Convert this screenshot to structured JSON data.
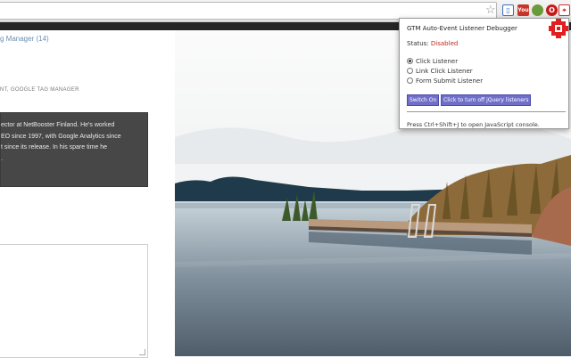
{
  "browser": {
    "extensions": [
      {
        "name": "bookmark-star-icon"
      },
      {
        "name": "page-extension-icon",
        "glyph": "[]"
      },
      {
        "name": "youtube-extension-icon",
        "glyph": "You"
      },
      {
        "name": "green-extension-icon",
        "glyph": "•"
      },
      {
        "name": "opera-extension-icon",
        "glyph": "O"
      },
      {
        "name": "gtm-debugger-extension-icon",
        "glyph": "⌖"
      }
    ]
  },
  "page": {
    "nav_link": "g Manager (14)",
    "tags": "NT, GOOGLE TAG MANAGER",
    "author_bio": "ector at NetBooster Finland. He's worked\nEO since 1997, with Google Analytics since\nt since its release. In his spare time he\n."
  },
  "popup": {
    "title": "GTM Auto-Event Listener Debugger",
    "status_label": "Status:",
    "status_value": "Disabled",
    "options": [
      {
        "label": "Click Listener",
        "selected": true
      },
      {
        "label": "Link Click Listener",
        "selected": false
      },
      {
        "label": "Form Submit Listener",
        "selected": false
      }
    ],
    "switch_button": "Switch On",
    "jquery_button": "Click to turn off jQuery listeners",
    "hint": "Press Ctrl+Shift+J to open JavaScript console."
  },
  "colors": {
    "status_disabled": "#c0271e",
    "button_bg": "#6f6fc9",
    "navbar": "#262626",
    "author_box": "#474747",
    "logo_red": "#e02020"
  }
}
